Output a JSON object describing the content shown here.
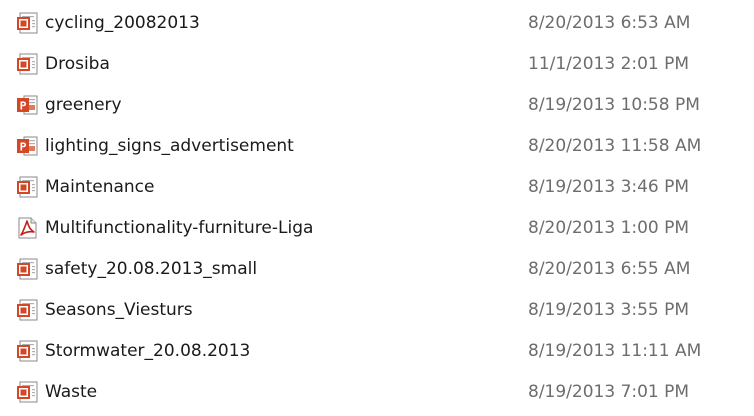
{
  "files": [
    {
      "name": "cycling_20082013",
      "date": "8/20/2013 6:53 AM",
      "icon": "pptx-slideshow-icon"
    },
    {
      "name": "Drosiba",
      "date": "11/1/2013 2:01 PM",
      "icon": "pptx-slideshow-icon"
    },
    {
      "name": "greenery",
      "date": "8/19/2013 10:58 PM",
      "icon": "powerpoint-icon"
    },
    {
      "name": "lighting_signs_advertisement",
      "date": "8/20/2013 11:58 AM",
      "icon": "powerpoint-icon"
    },
    {
      "name": "Maintenance",
      "date": "8/19/2013 3:46 PM",
      "icon": "pptx-slideshow-icon"
    },
    {
      "name": "Multifunctionality-furniture-Liga",
      "date": "8/20/2013 1:00 PM",
      "icon": "pdf-icon"
    },
    {
      "name": "safety_20.08.2013_small",
      "date": "8/20/2013 6:55 AM",
      "icon": "pptx-slideshow-icon"
    },
    {
      "name": "Seasons_Viesturs",
      "date": "8/19/2013 3:55 PM",
      "icon": "pptx-slideshow-icon"
    },
    {
      "name": "Stormwater_20.08.2013",
      "date": "8/19/2013 11:11 AM",
      "icon": "pptx-slideshow-icon"
    },
    {
      "name": "Waste",
      "date": "8/19/2013 7:01 PM",
      "icon": "pptx-slideshow-icon"
    }
  ],
  "colors": {
    "powerpoint": "#d24726",
    "pdf": "#c4201b",
    "name_text": "#1a1a1a",
    "date_text": "#6d6d6d"
  }
}
